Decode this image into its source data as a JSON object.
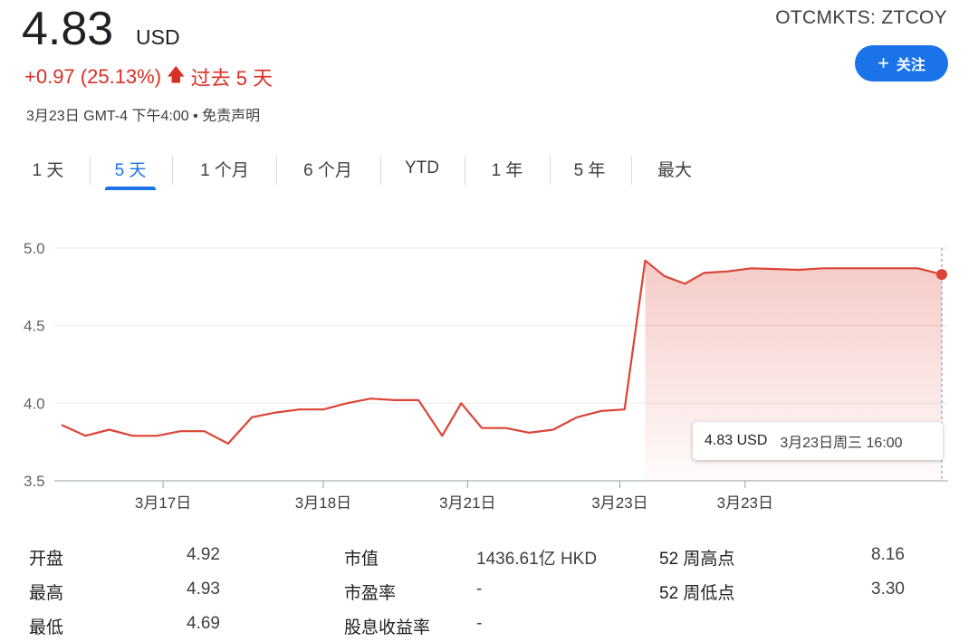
{
  "header": {
    "price": "4.83",
    "currency": "USD",
    "change_text": "+0.97 (25.13%)",
    "change_arrow": "🡅",
    "change_period": "过去 5 天",
    "timestamp": "3月23日 GMT-4 下午4:00",
    "separator": "•",
    "disclaimer": "免责声明",
    "ticker": "OTCMKTS: ZTCOY",
    "follow_label": "关注",
    "follow_icon": "+"
  },
  "tabs": [
    {
      "label": "1 天",
      "active": false
    },
    {
      "label": "5 天",
      "active": true
    },
    {
      "label": "1 个月",
      "active": false
    },
    {
      "label": "6 个月",
      "active": false
    },
    {
      "label": "YTD",
      "active": false
    },
    {
      "label": "1 年",
      "active": false
    },
    {
      "label": "5 年",
      "active": false
    },
    {
      "label": "最大",
      "active": false
    }
  ],
  "tooltip": {
    "value": "4.83 USD",
    "time": "3月23日周三 16:00"
  },
  "colors": {
    "line": "#db4437",
    "accent": "#1a73e8",
    "change": "#d93025"
  },
  "chart_data": {
    "type": "area",
    "ylim": [
      3.5,
      5.0
    ],
    "yticks": [
      3.5,
      4.0,
      4.5,
      5.0
    ],
    "ytick_labels": [
      "3.5",
      "4.0",
      "4.5",
      "5.0"
    ],
    "xtick_labels": [
      "3月17日",
      "3月18日",
      "3月21日",
      "3月23日",
      "3月23日"
    ],
    "xtick_index": [
      6.4,
      16.5,
      25.6,
      35.2,
      43.1
    ],
    "values": [
      3.86,
      3.79,
      3.83,
      3.79,
      3.79,
      3.82,
      3.82,
      3.74,
      3.91,
      3.94,
      3.96,
      3.96,
      4.0,
      4.03,
      4.02,
      4.02,
      3.79,
      4.0,
      3.84,
      3.84,
      3.81,
      3.83,
      3.91,
      3.95,
      3.96,
      4.92,
      4.82,
      4.77,
      4.84,
      4.85,
      4.87,
      4.865,
      4.86,
      4.87,
      4.87,
      4.87,
      4.87,
      4.87,
      4.83
    ],
    "x_index": [
      0,
      1.5,
      3,
      4.5,
      6,
      7.5,
      9,
      10.5,
      12,
      13.5,
      15,
      16.5,
      18,
      19.5,
      21,
      22.5,
      24,
      25.2,
      26.5,
      28,
      29.5,
      31,
      32.5,
      34,
      35.5,
      36.8,
      38,
      39.3,
      40.5,
      42,
      43.5,
      45,
      46.5,
      48,
      49.5,
      51,
      52.5,
      54,
      55.5
    ],
    "x_max": 55.5,
    "grid": true,
    "last_point_marker": true
  },
  "stats": [
    [
      {
        "label": "开盘",
        "value": "4.92"
      },
      {
        "label": "市值",
        "value": "1436.61亿 HKD"
      },
      {
        "label": "52 周高点",
        "value": "8.16"
      }
    ],
    [
      {
        "label": "最高",
        "value": "4.93"
      },
      {
        "label": "市盈率",
        "value": "-"
      },
      {
        "label": "52 周低点",
        "value": "3.30"
      }
    ],
    [
      {
        "label": "最低",
        "value": "4.69"
      },
      {
        "label": "股息收益率",
        "value": "-"
      }
    ]
  ]
}
